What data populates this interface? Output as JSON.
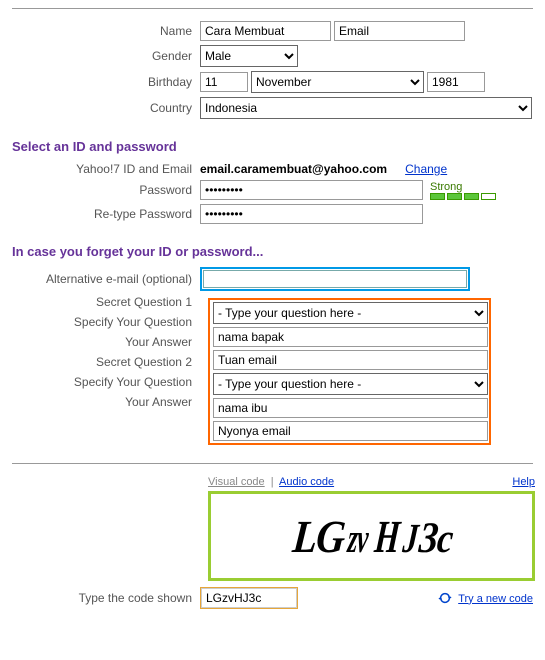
{
  "personal": {
    "name_label": "Name",
    "first_name": "Cara Membuat",
    "last_name": "Email",
    "gender_label": "Gender",
    "gender": "Male",
    "birthday_label": "Birthday",
    "birth_day": "11",
    "birth_month": "November",
    "birth_year": "1981",
    "country_label": "Country",
    "country": "Indonesia"
  },
  "id_section": {
    "heading": "Select an ID and password",
    "id_label": "Yahoo!7 ID and Email",
    "email": "email.caramembuat@yahoo.com",
    "change": "Change",
    "password_label": "Password",
    "password": "•••••••••",
    "retype_label": "Re-type Password",
    "retype": "•••••••••",
    "strength_label": "Strong"
  },
  "forgot_section": {
    "heading": "In case you forget your ID or password...",
    "alt_email_label": "Alternative e-mail (optional)",
    "alt_email": "",
    "q1_label": "Secret Question 1",
    "q1_value": "- Type your question here -",
    "spec1_label": "Specify Your Question",
    "spec1_value": "nama bapak",
    "ans1_label": "Your Answer",
    "ans1_value": "Tuan email",
    "q2_label": "Secret Question 2",
    "q2_value": "- Type your question here -",
    "spec2_label": "Specify Your Question",
    "spec2_value": "nama ibu",
    "ans2_label": "Your Answer",
    "ans2_value": "Nyonya email"
  },
  "captcha": {
    "visual_label": "Visual code",
    "audio_label": "Audio code",
    "help_label": "Help",
    "image_text": "LGzvHJ3c",
    "type_label": "Type the code shown",
    "input_value": "LGzvHJ3c",
    "new_code": "Try a new code"
  }
}
